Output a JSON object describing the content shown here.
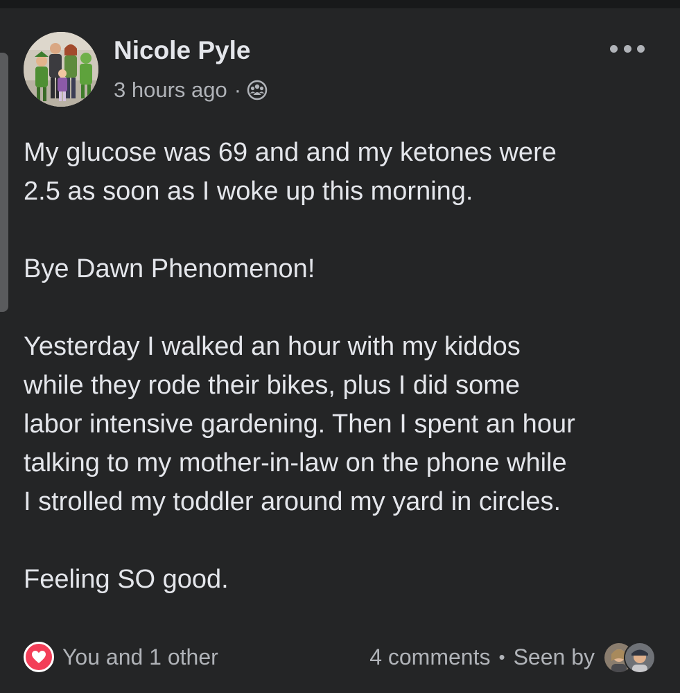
{
  "post": {
    "author_name": "Nicole Pyle",
    "timestamp": "3 hours ago",
    "meta_separator": "·",
    "privacy_icon": "group-icon",
    "more_icon": "more-options-icon",
    "body": {
      "p1": "My glucose was 69 and and my ketones were\n2.5 as soon as I woke up this morning.",
      "p2": "Bye Dawn Phenomenon!",
      "p3": "Yesterday I walked an hour with my kiddos\nwhile they rode their bikes, plus I did some\nlabor intensive gardening. Then I spent an hour\ntalking to my mother-in-law on the phone while\nI strolled my toddler around my yard in circles.",
      "p4": "Feeling SO good."
    }
  },
  "footer": {
    "reaction_icon": "heart-icon",
    "reaction_text": "You and 1 other",
    "comments": "4 comments",
    "separator": "•",
    "seen_by": "Seen by"
  },
  "colors": {
    "background": "#242526",
    "text_primary": "#e4e6eb",
    "text_secondary": "#b0b3b8",
    "heart": "#f33e58"
  }
}
